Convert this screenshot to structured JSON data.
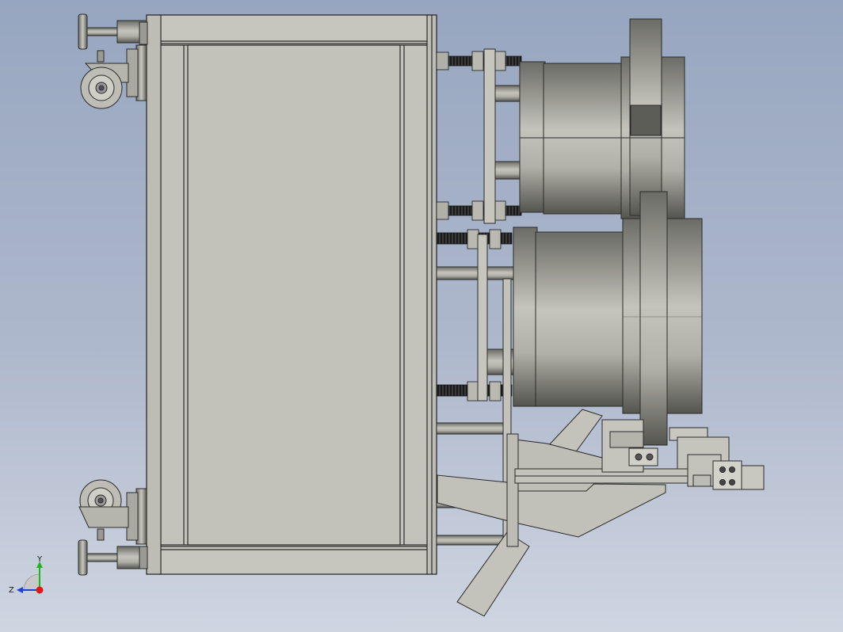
{
  "view": {
    "background_top": "#97a6c0",
    "background_bottom": "#cfd5e1",
    "part_fill": "#c3c3bb",
    "edge_color": "#2a2a2a",
    "cylinder_dark": "#5a5a55",
    "cylinder_light": "#b8b8b2"
  },
  "triad": {
    "y_label": "Y",
    "z_label": "Z",
    "y_color": "#18b818",
    "z_color": "#2040d8",
    "x_color": "#e01818"
  }
}
